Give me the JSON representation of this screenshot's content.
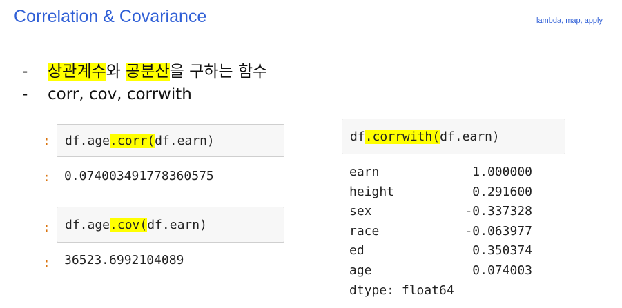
{
  "header": {
    "title": "Correlation & Covariance",
    "subtitle": "lambda, map, apply"
  },
  "bullets": [
    {
      "dash": "-",
      "parts": [
        {
          "text": "상관계수",
          "highlight": true
        },
        {
          "text": "와 ",
          "highlight": false
        },
        {
          "text": "공분산",
          "highlight": true
        },
        {
          "text": "을 구하는 함수",
          "highlight": false
        }
      ]
    },
    {
      "dash": "-",
      "parts": [
        {
          "text": "corr, cov, corrwith",
          "highlight": false
        }
      ]
    }
  ],
  "cells": {
    "corr": {
      "prompt": ":",
      "code_pre": "df.age",
      "code_hl": ".corr(",
      "code_post": "df.earn)",
      "out_prompt": ":",
      "output": "0.074003491778360575"
    },
    "cov": {
      "prompt": ":",
      "code_pre": "df.age",
      "code_hl": ".cov(",
      "code_post": "df.earn)",
      "out_prompt": ":",
      "output": "36523.6992104089"
    },
    "corrwith": {
      "code_pre": "df",
      "code_hl": ".corrwith(",
      "code_post": "df.earn)",
      "rows": [
        {
          "key": "earn",
          "value": "1.000000"
        },
        {
          "key": "height",
          "value": "0.291600"
        },
        {
          "key": "sex",
          "value": "-0.337328"
        },
        {
          "key": "race",
          "value": "-0.063977"
        },
        {
          "key": "ed",
          "value": "0.350374"
        },
        {
          "key": "age",
          "value": "0.074003"
        }
      ],
      "dtype": "dtype: float64"
    }
  },
  "colors": {
    "title": "#2f5fd6",
    "highlight": "#ffff00",
    "prompt": "#d9730d",
    "cell_bg": "#f7f7f7"
  }
}
